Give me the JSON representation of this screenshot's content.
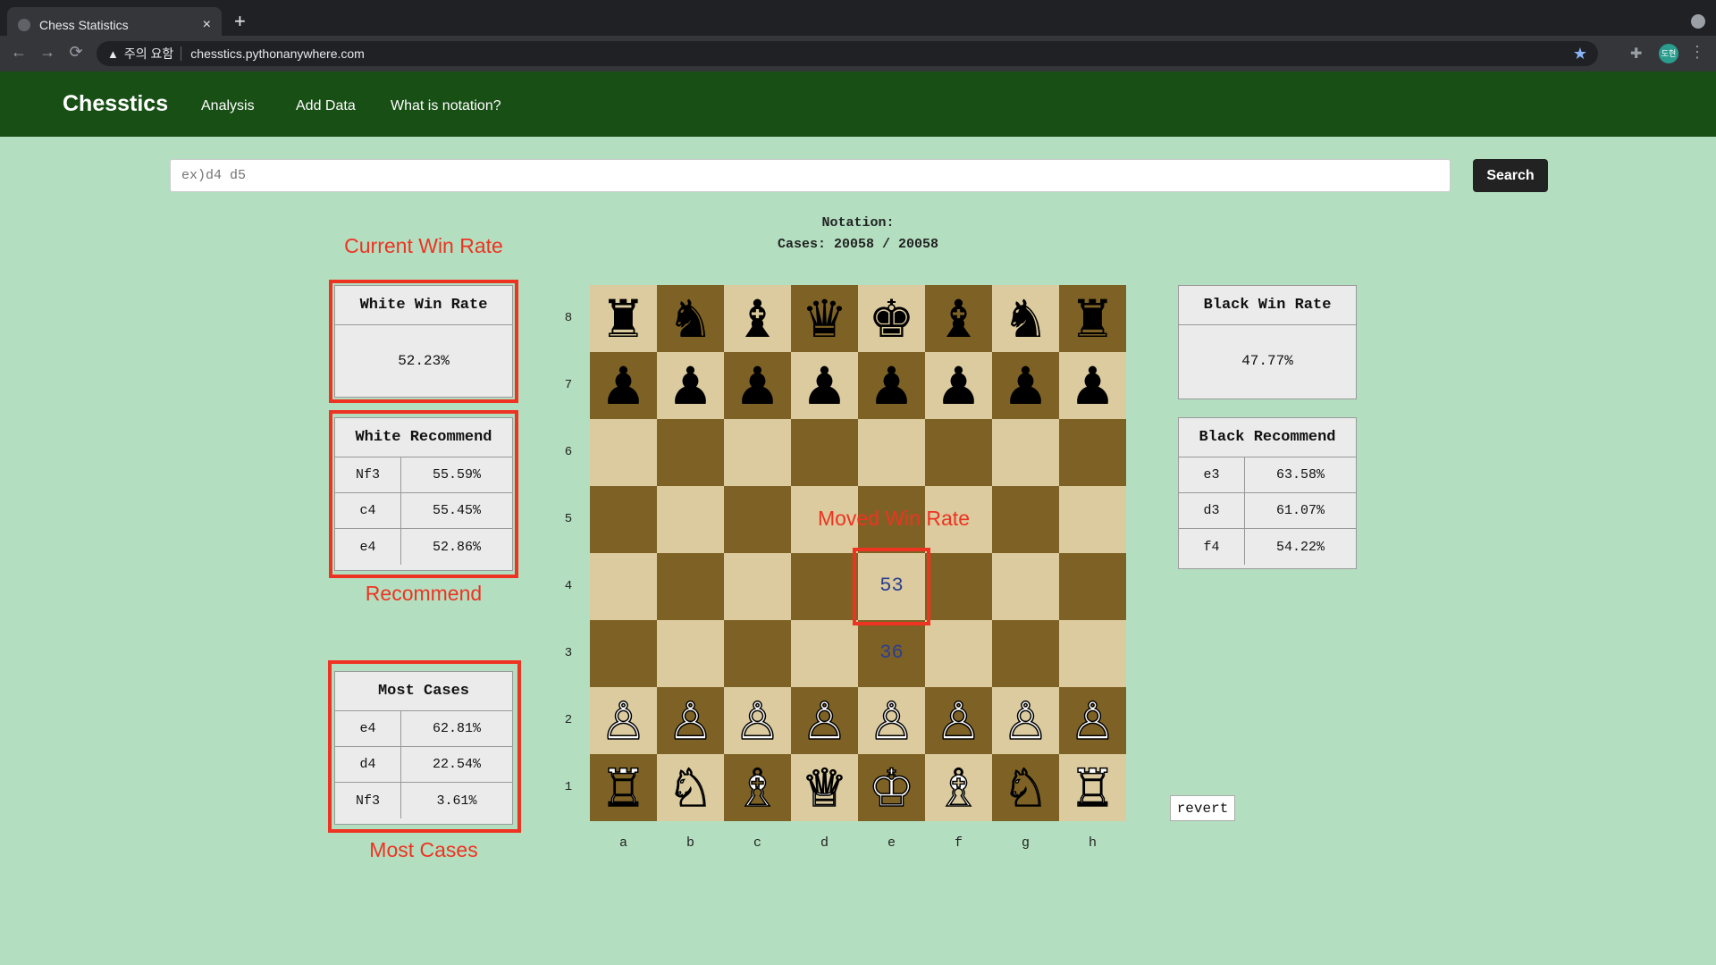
{
  "browser": {
    "tab_title": "Chess Statistics",
    "tab_close": "×",
    "new_tab": "+",
    "security_warning": "주의 요함",
    "url": "chesstics.pythonanywhere.com",
    "profile_text": "도현"
  },
  "navbar": {
    "brand": "Chesstics",
    "links": [
      "Analysis",
      "Add Data",
      "What is notation?"
    ]
  },
  "search": {
    "placeholder": "ex)d4 d5",
    "button": "Search"
  },
  "info": {
    "notation_line": "Notation:",
    "cases_line": "Cases: 20058 / 20058"
  },
  "annotations": {
    "current_win_rate": "Current Win Rate",
    "recommend": "Recommend",
    "most_cases": "Most Cases",
    "moved_win_rate": "Moved Win Rate",
    "color": "#ee3322"
  },
  "white_win": {
    "title": "White Win Rate",
    "value": "52.23%"
  },
  "black_win": {
    "title": "Black Win Rate",
    "value": "47.77%"
  },
  "white_recommend": {
    "title": "White Recommend",
    "rows": [
      {
        "move": "Nf3",
        "pct": "55.59%"
      },
      {
        "move": "c4",
        "pct": "55.45%"
      },
      {
        "move": "e4",
        "pct": "52.86%"
      }
    ]
  },
  "black_recommend": {
    "title": "Black Recommend",
    "rows": [
      {
        "move": "e3",
        "pct": "63.58%"
      },
      {
        "move": "d3",
        "pct": "61.07%"
      },
      {
        "move": "f4",
        "pct": "54.22%"
      }
    ]
  },
  "most_cases": {
    "title": "Most Cases",
    "rows": [
      {
        "move": "e4",
        "pct": "62.81%"
      },
      {
        "move": "d4",
        "pct": "22.54%"
      },
      {
        "move": "Nf3",
        "pct": "3.61%"
      }
    ]
  },
  "board": {
    "ranks": [
      "8",
      "7",
      "6",
      "5",
      "4",
      "3",
      "2",
      "1"
    ],
    "files": [
      "a",
      "b",
      "c",
      "d",
      "e",
      "f",
      "g",
      "h"
    ],
    "pieces": [
      [
        "♜",
        "♞",
        "♝",
        "♛",
        "♚",
        "♝",
        "♞",
        "♜"
      ],
      [
        "♟",
        "♟",
        "♟",
        "♟",
        "♟",
        "♟",
        "♟",
        "♟"
      ],
      [
        "",
        "",
        "",
        "",
        "",
        "",
        "",
        ""
      ],
      [
        "",
        "",
        "",
        "",
        "",
        "",
        "",
        ""
      ],
      [
        "",
        "",
        "",
        "",
        "",
        "",
        "",
        ""
      ],
      [
        "",
        "",
        "",
        "",
        "",
        "",
        "",
        ""
      ],
      [
        "♙",
        "♙",
        "♙",
        "♙",
        "♙",
        "♙",
        "♙",
        "♙"
      ],
      [
        "♖",
        "♘",
        "♗",
        "♕",
        "♔",
        "♗",
        "♘",
        "♖"
      ]
    ],
    "light_color": "#dbcb9e",
    "dark_color": "#7e6225",
    "moved_rates": [
      {
        "square": "e4",
        "value": "53"
      },
      {
        "square": "e3",
        "value": "36"
      }
    ]
  },
  "revert_button": "revert"
}
